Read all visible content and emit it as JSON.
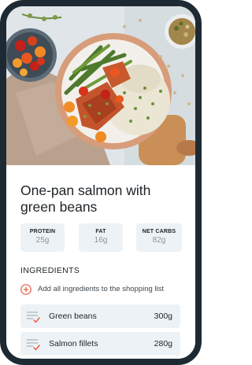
{
  "recipe": {
    "title": "One-pan salmon with green beans",
    "photo_icon": "recipe-photo"
  },
  "macros": [
    {
      "label": "PROTEIN",
      "value": "25g"
    },
    {
      "label": "FAT",
      "value": "16g"
    },
    {
      "label": "NET CARBS",
      "value": "82g"
    }
  ],
  "ingredients": {
    "heading": "INGREDIENTS",
    "add_all_label": "Add all ingredients to the shopping list",
    "add_icon": "plus-circle-icon",
    "item_icon": "shopping-list-check-icon",
    "items": [
      {
        "name": "Green beans",
        "qty": "300g"
      },
      {
        "name": "Salmon fillets",
        "qty": "280g"
      }
    ]
  },
  "colors": {
    "accent": "#e8553f",
    "card_bg": "#edf2f6",
    "frame": "#1e2a33",
    "text": "#1d2328",
    "muted": "#8a949c"
  }
}
